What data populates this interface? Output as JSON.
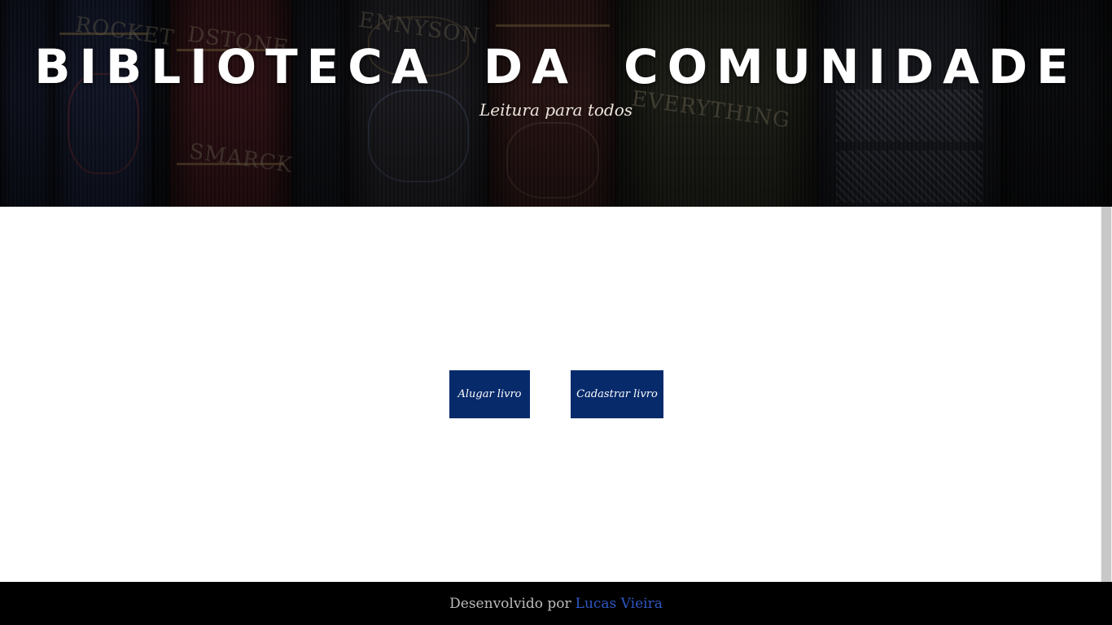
{
  "header": {
    "title": "BIBLIOTECA DA COMUNIDADE",
    "subtitle": "Leitura para todos"
  },
  "actions": {
    "rent_label": "Alugar livro",
    "register_label": "Cadastrar livro"
  },
  "footer": {
    "prefix": "Desenvolvido por",
    "author": "Lucas Vieira"
  },
  "colors": {
    "button_bg": "#072a6b",
    "footer_bg": "#000000",
    "author_link": "#2f58c4"
  }
}
